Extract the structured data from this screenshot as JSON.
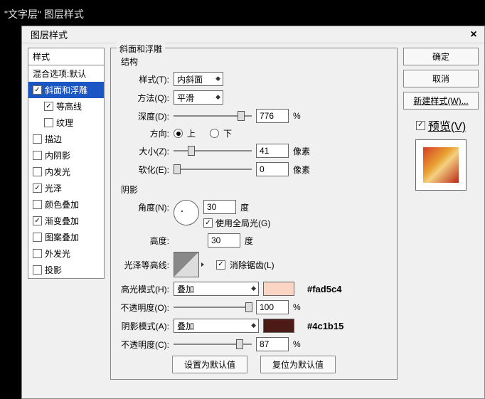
{
  "app_title": "\"文字层\" 图层样式",
  "dialog_title": "图层样式",
  "close": "×",
  "styles_header": "样式",
  "blend_options": "混合选项:默认",
  "style_items": [
    {
      "label": "斜面和浮雕",
      "checked": true,
      "selected": true,
      "indent": 1
    },
    {
      "label": "等高线",
      "checked": true,
      "selected": false,
      "indent": 2
    },
    {
      "label": "纹理",
      "checked": false,
      "selected": false,
      "indent": 2
    },
    {
      "label": "描边",
      "checked": false,
      "selected": false,
      "indent": 1
    },
    {
      "label": "内阴影",
      "checked": false,
      "selected": false,
      "indent": 1
    },
    {
      "label": "内发光",
      "checked": false,
      "selected": false,
      "indent": 1
    },
    {
      "label": "光泽",
      "checked": true,
      "selected": false,
      "indent": 1
    },
    {
      "label": "颜色叠加",
      "checked": false,
      "selected": false,
      "indent": 1
    },
    {
      "label": "渐变叠加",
      "checked": true,
      "selected": false,
      "indent": 1
    },
    {
      "label": "图案叠加",
      "checked": false,
      "selected": false,
      "indent": 1
    },
    {
      "label": "外发光",
      "checked": false,
      "selected": false,
      "indent": 1
    },
    {
      "label": "投影",
      "checked": false,
      "selected": false,
      "indent": 1
    }
  ],
  "group_title": "斜面和浮雕",
  "structure_title": "结构",
  "style_label": "样式(T):",
  "style_value": "内斜面",
  "method_label": "方法(Q):",
  "method_value": "平滑",
  "depth_label": "深度(D):",
  "depth_value": "776",
  "depth_unit": "%",
  "direction_label": "方向:",
  "dir_up": "上",
  "dir_down": "下",
  "size_label": "大小(Z):",
  "size_value": "41",
  "size_unit": "像素",
  "soften_label": "软化(E):",
  "soften_value": "0",
  "soften_unit": "像素",
  "shadow_title": "阴影",
  "angle_label": "角度(N):",
  "angle_value": "30",
  "angle_unit": "度",
  "use_global_light": "使用全局光(G)",
  "altitude_label": "高度:",
  "altitude_value": "30",
  "altitude_unit": "度",
  "gloss_contour_label": "光泽等高线:",
  "antialias": "消除锯齿(L)",
  "highlight_mode_label": "高光模式(H):",
  "highlight_mode_value": "叠加",
  "highlight_color": "#fad5c4",
  "highlight_hex": "#fad5c4",
  "opacity_label": "不透明度(O):",
  "opacity_value": "100",
  "opacity_unit": "%",
  "shadow_mode_label": "阴影模式(A):",
  "shadow_mode_value": "叠加",
  "shadow_color": "#4c1b15",
  "shadow_hex": "#4c1b15",
  "opacity2_label": "不透明度(C):",
  "opacity2_value": "87",
  "opacity2_unit": "%",
  "make_default": "设置为默认值",
  "reset_default": "复位为默认值",
  "ok": "确定",
  "cancel": "取消",
  "new_style": "新建样式(W)...",
  "preview_label": "预览(V)"
}
